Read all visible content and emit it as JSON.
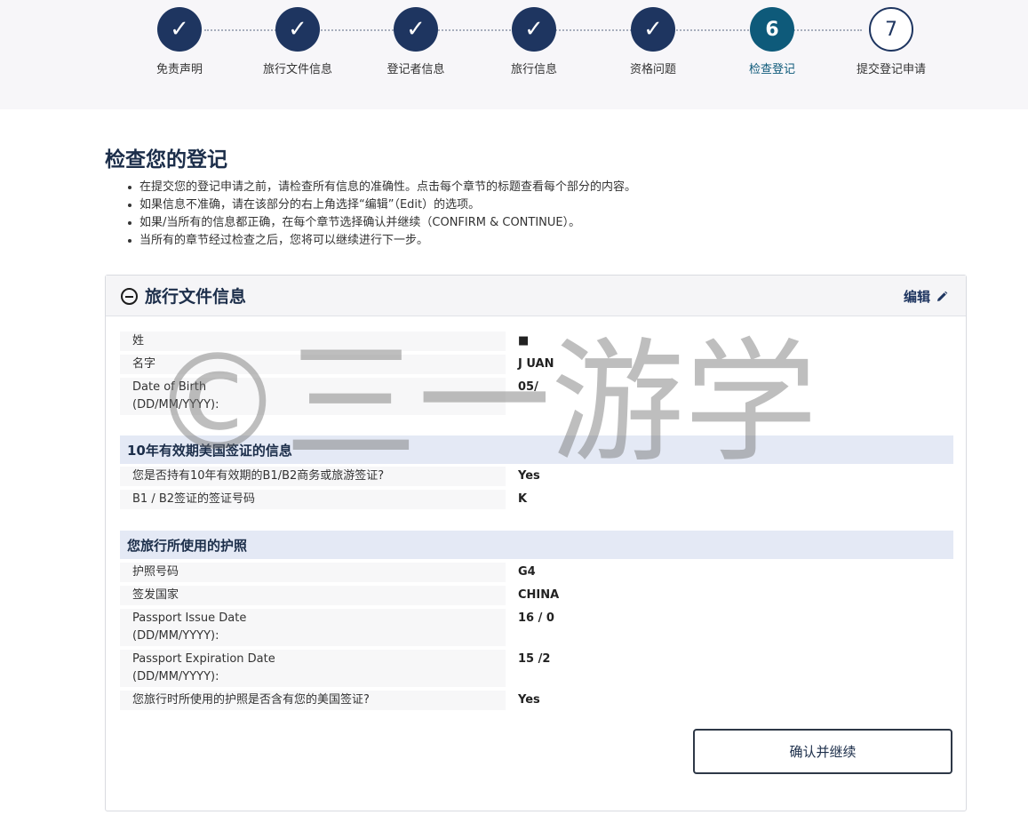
{
  "steps": [
    {
      "marker": "✓",
      "label": "免责声明"
    },
    {
      "marker": "✓",
      "label": "旅行文件信息"
    },
    {
      "marker": "✓",
      "label": "登记者信息"
    },
    {
      "marker": "✓",
      "label": "旅行信息"
    },
    {
      "marker": "✓",
      "label": "资格问题"
    },
    {
      "marker": "6",
      "label": "检查登记"
    },
    {
      "marker": "7",
      "label": "提交登记申请"
    }
  ],
  "page_title": "检查您的登记",
  "instructions": [
    "在提交您的登记申请之前，请检查所有信息的准确性。点击每个章节的标题查看每个部分的内容。",
    "如果信息不准确，请在该部分的右上角选择“编辑”（Edit）的选项。",
    "如果/当所有的信息都正确，在每个章节选择确认并继续（CONFIRM & CONTINUE）。",
    "当所有的章节经过检查之后，您将可以继续进行下一步。"
  ],
  "panel": {
    "title": "旅行文件信息",
    "edit_label": "编辑",
    "personal": [
      {
        "label": "姓",
        "value": "■"
      },
      {
        "label": "名字",
        "value": "J      UAN"
      },
      {
        "label": "Date of Birth\n(DD/MM/YYYY):",
        "value": "05/"
      }
    ],
    "visa_section": {
      "heading": "10年有效期美国签证的信息",
      "rows": [
        {
          "label": "您是否持有10年有效期的B1/B2商务或旅游签证?",
          "value": "Yes"
        },
        {
          "label": "B1 / B2签证的签证号码",
          "value": "K"
        }
      ]
    },
    "passport_section": {
      "heading": "您旅行所使用的护照",
      "rows": [
        {
          "label": "护照号码",
          "value": "G4"
        },
        {
          "label": "签发国家",
          "value": "CHINA"
        },
        {
          "label": "Passport Issue Date\n(DD/MM/YYYY):",
          "value": "16    /    0"
        },
        {
          "label": "Passport Expiration Date\n(DD/MM/YYYY):",
          "value": "15    /2"
        },
        {
          "label": "您旅行时所使用的护照是否含有您的美国签证?",
          "value": "Yes"
        }
      ]
    },
    "confirm_label": "确认并继续"
  },
  "watermark": "©三一游学"
}
